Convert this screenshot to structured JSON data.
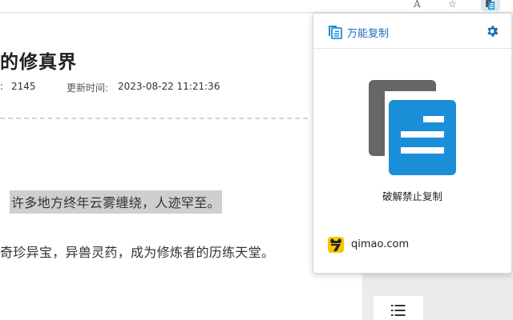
{
  "browser": {
    "font_icon_glyph": "A",
    "star_icon_glyph": "☆"
  },
  "page": {
    "title": "的修真界",
    "meta_colon": ":",
    "word_count": "2145",
    "update_label": "更新时间:",
    "update_time": "2023-08-22 11:21:36",
    "paragraph_1": "许多地方终年云雾缠绕，人迹罕至。",
    "paragraph_2": "奇珍异宝，异兽灵药，成为修炼者的历练天堂。"
  },
  "popup": {
    "title": "万能复制",
    "action_label": "破解禁止复制",
    "site_name": "qimao.com"
  },
  "colors": {
    "brand_blue": "#1a8fd8",
    "icon_gray": "#666666",
    "gear_blue": "#1c6fb8",
    "site_icon_yellow": "#f7c600"
  }
}
